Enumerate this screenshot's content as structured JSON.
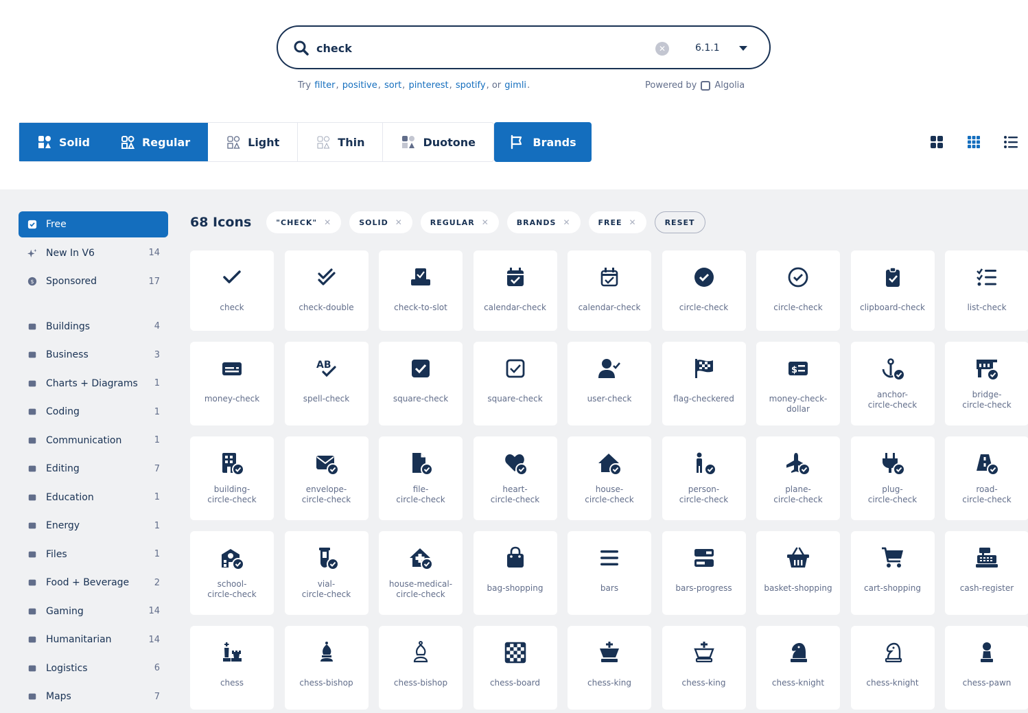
{
  "search": {
    "query": "check",
    "version": "6.1.1",
    "clear_icon": "close-icon"
  },
  "suggest": {
    "try": "Try",
    "links": [
      "filter",
      "positive",
      "sort",
      "pinterest",
      "spotify"
    ],
    "or": "or",
    "last": "gimli",
    "end": "."
  },
  "powered": {
    "label": "Powered by",
    "brand": "Algolia"
  },
  "styles": [
    {
      "label": "Solid",
      "active": true
    },
    {
      "label": "Regular",
      "active": true
    },
    {
      "label": "Light",
      "active": false
    },
    {
      "label": "Thin",
      "active": false
    },
    {
      "label": "Duotone",
      "active": false
    }
  ],
  "brands_label": "Brands",
  "colors": {
    "accent": "#146ebe",
    "navy": "#183153",
    "muted": "#616d8a",
    "panel": "#f0f1f3"
  },
  "sidebar": {
    "top": [
      {
        "label": "Free",
        "count": "",
        "icon": "square-check-icon"
      },
      {
        "label": "New In V6",
        "count": "14",
        "icon": "sparkles-icon"
      },
      {
        "label": "Sponsored",
        "count": "17",
        "icon": "dollar-circle-icon"
      }
    ],
    "categories": [
      {
        "label": "Buildings",
        "count": "4",
        "icon": "building-columns-icon"
      },
      {
        "label": "Business",
        "count": "3",
        "icon": "briefcase-icon"
      },
      {
        "label": "Charts + Diagrams",
        "count": "1",
        "icon": "chart-icon"
      },
      {
        "label": "Coding",
        "count": "1",
        "icon": "code-icon"
      },
      {
        "label": "Communication",
        "count": "1",
        "icon": "message-icon"
      },
      {
        "label": "Editing",
        "count": "7",
        "icon": "pen-icon"
      },
      {
        "label": "Education",
        "count": "1",
        "icon": "graduation-cap-icon"
      },
      {
        "label": "Energy",
        "count": "1",
        "icon": "bolt-icon"
      },
      {
        "label": "Files",
        "count": "1",
        "icon": "copy-icon"
      },
      {
        "label": "Food + Beverage",
        "count": "2",
        "icon": "utensils-icon"
      },
      {
        "label": "Gaming",
        "count": "14",
        "icon": "chess-pawn-icon"
      },
      {
        "label": "Humanitarian",
        "count": "14",
        "icon": "trophy-icon"
      },
      {
        "label": "Logistics",
        "count": "6",
        "icon": "truck-icon"
      },
      {
        "label": "Maps",
        "count": "7",
        "icon": "map-icon"
      }
    ]
  },
  "results": {
    "count": "68 Icons",
    "chips": [
      "\"CHECK\"",
      "SOLID",
      "REGULAR",
      "BRANDS",
      "FREE"
    ],
    "reset": "RESET"
  },
  "icons": [
    {
      "name": "check",
      "kind": "check"
    },
    {
      "name": "check-double",
      "kind": "check-double"
    },
    {
      "name": "check-to-slot",
      "kind": "slot"
    },
    {
      "name": "calendar-check",
      "kind": "cal-solid"
    },
    {
      "name": "calendar-check",
      "kind": "cal-reg"
    },
    {
      "name": "circle-check",
      "kind": "circle-solid"
    },
    {
      "name": "circle-check",
      "kind": "circle-reg"
    },
    {
      "name": "clipboard-check",
      "kind": "clipboard"
    },
    {
      "name": "list-check",
      "kind": "list"
    },
    {
      "name": "money-check",
      "kind": "money"
    },
    {
      "name": "spell-check",
      "kind": "spell"
    },
    {
      "name": "square-check",
      "kind": "square-solid"
    },
    {
      "name": "square-check",
      "kind": "square-reg"
    },
    {
      "name": "user-check",
      "kind": "user"
    },
    {
      "name": "flag-checkered",
      "kind": "flag"
    },
    {
      "name": "money-check-dollar",
      "kind": "money-dollar"
    },
    {
      "name": "anchor-circle-check",
      "kind": "anchor"
    },
    {
      "name": "bridge-circle-check",
      "kind": "bridge"
    },
    {
      "name": "building-circle-check",
      "kind": "building"
    },
    {
      "name": "envelope-circle-check",
      "kind": "envelope"
    },
    {
      "name": "file-circle-check",
      "kind": "file"
    },
    {
      "name": "heart-circle-check",
      "kind": "heart"
    },
    {
      "name": "house-circle-check",
      "kind": "house"
    },
    {
      "name": "person-circle-check",
      "kind": "person"
    },
    {
      "name": "plane-circle-check",
      "kind": "plane"
    },
    {
      "name": "plug-circle-check",
      "kind": "plug"
    },
    {
      "name": "road-circle-check",
      "kind": "road"
    },
    {
      "name": "school-circle-check",
      "kind": "school"
    },
    {
      "name": "vial-circle-check",
      "kind": "vial"
    },
    {
      "name": "house-medical-circle-check",
      "kind": "house-med"
    },
    {
      "name": "bag-shopping",
      "kind": "bag"
    },
    {
      "name": "bars",
      "kind": "bars"
    },
    {
      "name": "bars-progress",
      "kind": "bars-progress"
    },
    {
      "name": "basket-shopping",
      "kind": "basket"
    },
    {
      "name": "cart-shopping",
      "kind": "cart"
    },
    {
      "name": "cash-register",
      "kind": "register"
    },
    {
      "name": "chess",
      "kind": "chess"
    },
    {
      "name": "chess-bishop",
      "kind": "bishop-solid"
    },
    {
      "name": "chess-bishop",
      "kind": "bishop-reg"
    },
    {
      "name": "chess-board",
      "kind": "board"
    },
    {
      "name": "chess-king",
      "kind": "king-solid"
    },
    {
      "name": "chess-king",
      "kind": "king-reg"
    },
    {
      "name": "chess-knight",
      "kind": "knight-solid"
    },
    {
      "name": "chess-knight",
      "kind": "knight-reg"
    },
    {
      "name": "chess-pawn",
      "kind": "pawn"
    }
  ]
}
